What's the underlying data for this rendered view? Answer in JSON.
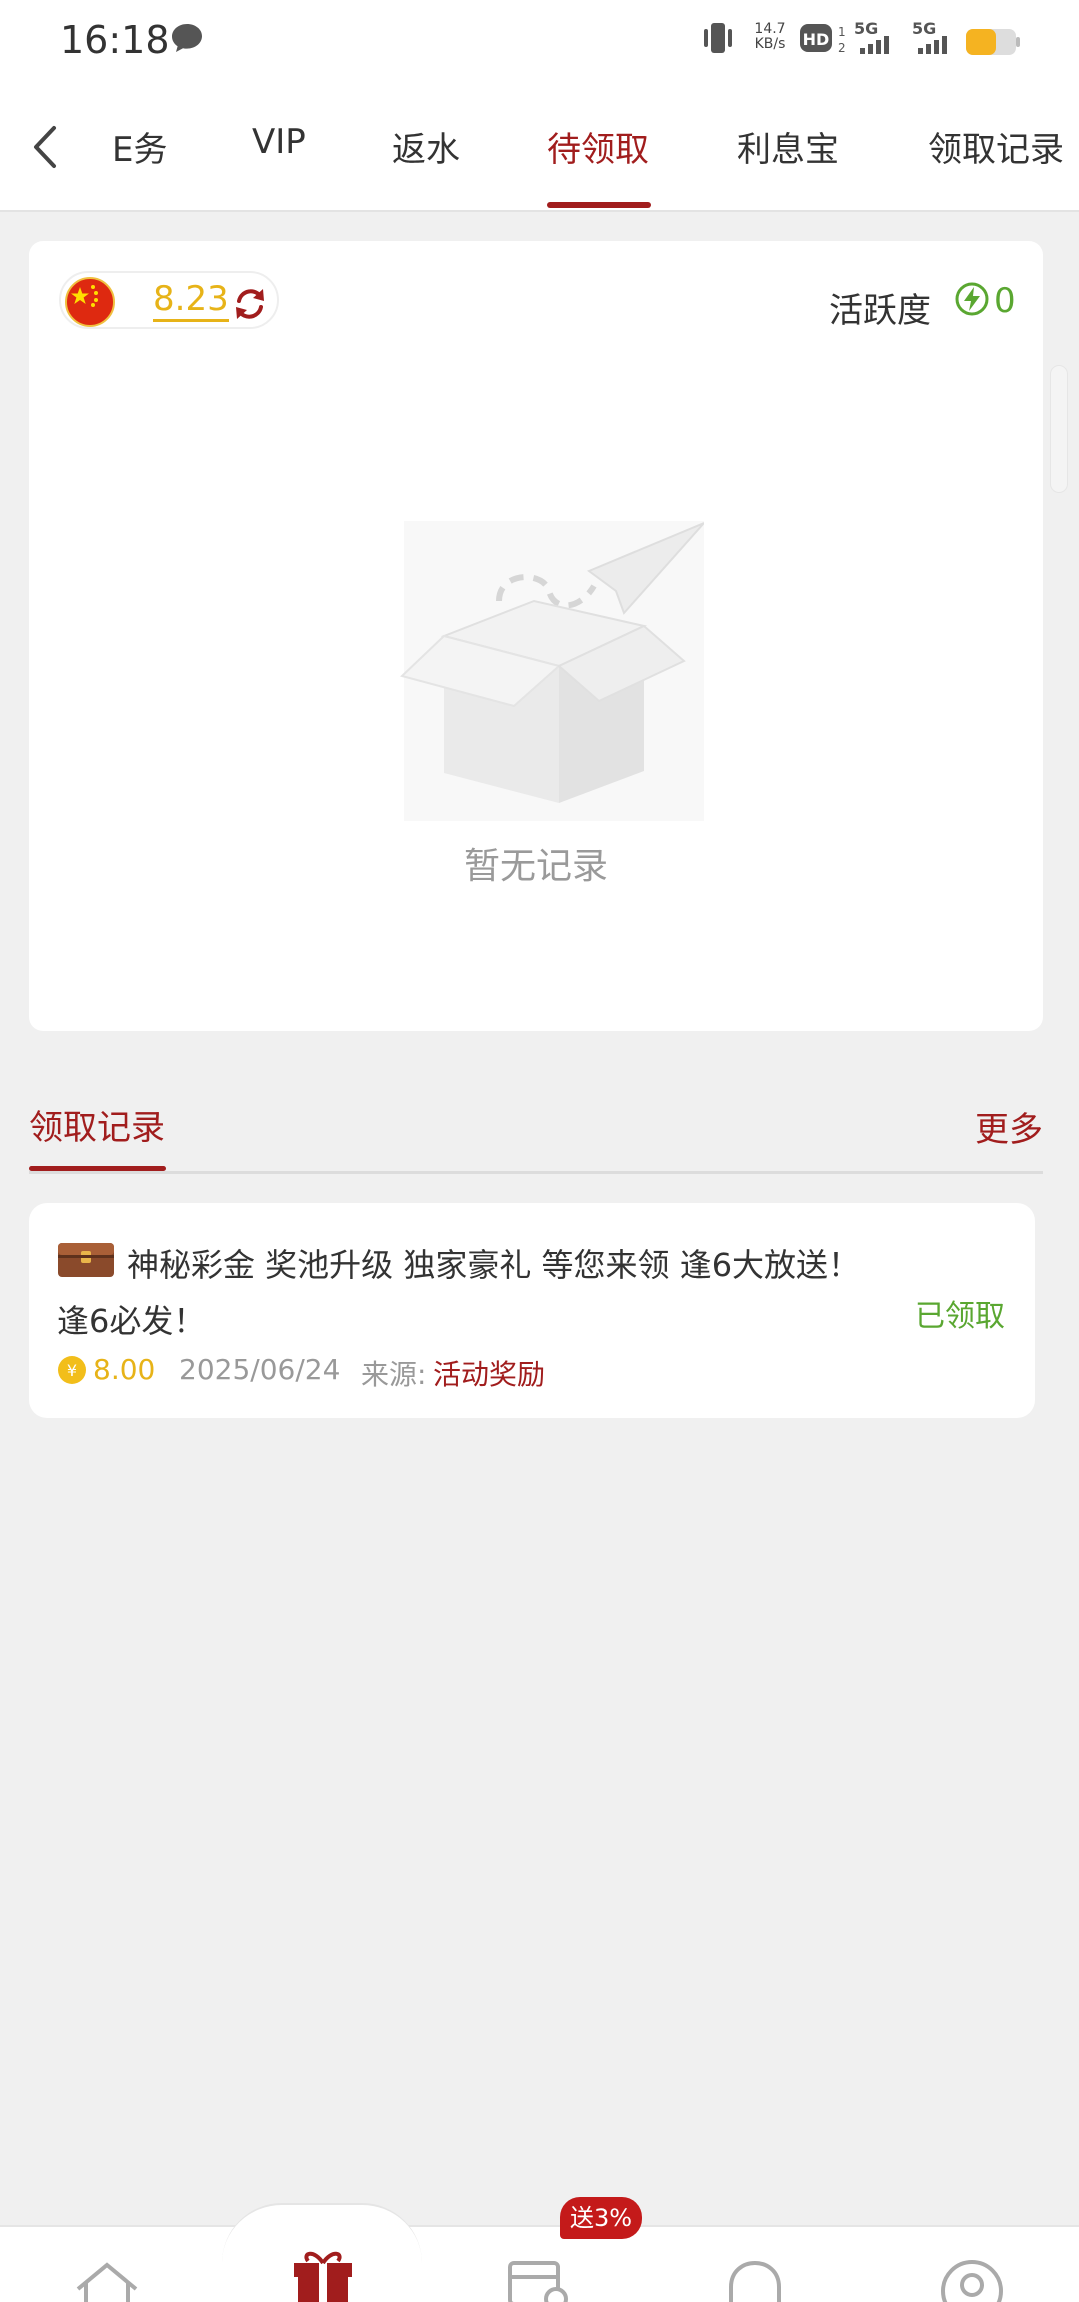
{
  "status_bar": {
    "time": "16:18",
    "net_speed_value": "14.7",
    "net_speed_unit": "KB/s",
    "hd_label": "HD",
    "signal_1": "5G",
    "signal_2": "5G",
    "icons": [
      "chat-bubble-icon",
      "vibrate-icon",
      "hd-icon",
      "signal-icon",
      "signal-icon",
      "battery-icon"
    ],
    "battery_color": "#f5b321"
  },
  "top_nav": {
    "tabs": [
      {
        "label": "任务",
        "display": "E务",
        "active": false
      },
      {
        "label": "VIP",
        "active": false
      },
      {
        "label": "返水",
        "active": false
      },
      {
        "label": "待领取",
        "active": true
      },
      {
        "label": "利息宝",
        "active": false
      },
      {
        "label": "领取记录",
        "active": false
      }
    ],
    "accent_color": "#a11d1d"
  },
  "balance": {
    "value": "8.23",
    "currency_flag": "china-flag-icon"
  },
  "activity": {
    "label": "活跃度",
    "value": "0"
  },
  "empty_state": {
    "text": "暂无记录"
  },
  "records_section": {
    "title": "领取记录",
    "more_label": "更多",
    "records": [
      {
        "title": "神秘彩金 奖池升级 独家豪礼 等您来领 逢6大放送！逢6必发！",
        "status": "已领取",
        "amount": "8.00",
        "date": "2025/06/24",
        "source_label": "来源:",
        "source_value": "活动奖励"
      }
    ]
  },
  "bottom_nav": {
    "items": [
      "home-icon",
      "gift-icon",
      "record-icon",
      "support-icon",
      "profile-icon"
    ],
    "promo_badge": "送3%"
  }
}
